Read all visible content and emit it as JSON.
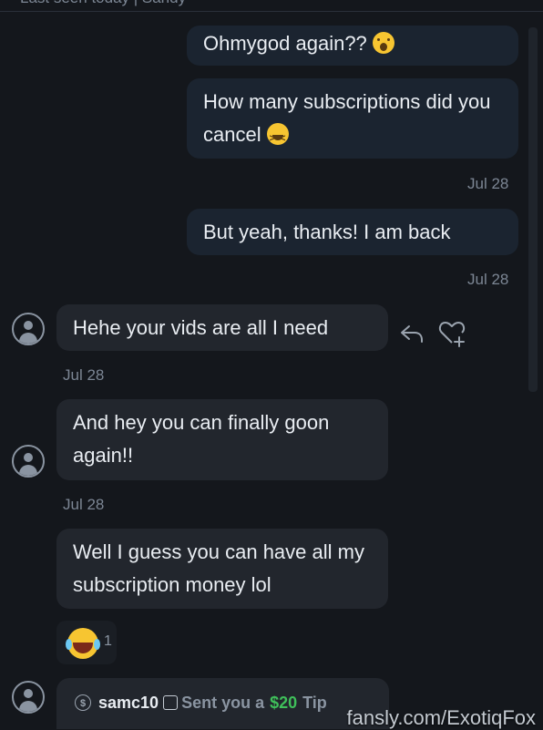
{
  "header": {
    "status_text": "Last seen today | Sandy"
  },
  "messages": [
    {
      "id": "m1",
      "direction": "outgoing",
      "text": "Ohmygod again??",
      "emoji": "astonished-face-emoji"
    },
    {
      "id": "m2",
      "direction": "outgoing",
      "text_line1": "How many subscriptions did you",
      "text_line2": "cancel",
      "emoji": "grinning-squinting-face-emoji"
    },
    {
      "id": "m3",
      "direction": "outgoing",
      "text": "But yeah, thanks! I am back"
    },
    {
      "id": "m4",
      "direction": "incoming",
      "text": "Hehe your vids are all I need"
    },
    {
      "id": "m5",
      "direction": "incoming",
      "text_line1": "And hey you can finally goon",
      "text_line2": "again!!"
    },
    {
      "id": "m6",
      "direction": "incoming",
      "text_line1": "Well I guess you can have all my",
      "text_line2": "subscription money lol"
    }
  ],
  "dates": {
    "d1": "Jul 28",
    "d2": "Jul 28",
    "d3": "Jul 28",
    "d4": "Jul 28"
  },
  "actions": {
    "reply_icon": "reply-icon",
    "like_icon": "heart-plus-icon"
  },
  "reaction": {
    "emoji": "face-with-tears-of-joy-emoji",
    "count": "1"
  },
  "tip": {
    "icon": "dollar-coin-icon",
    "username": "samc10",
    "note_icon": "note-icon",
    "sent_text": "Sent you a",
    "amount": "$20",
    "label": "Tip"
  },
  "watermark": "fansly.com/ExotiqFox",
  "colors": {
    "background": "#14171c",
    "outgoing_bubble": "#1b2430",
    "incoming_bubble": "#22262d",
    "tip_amount": "#3fbf5a"
  }
}
